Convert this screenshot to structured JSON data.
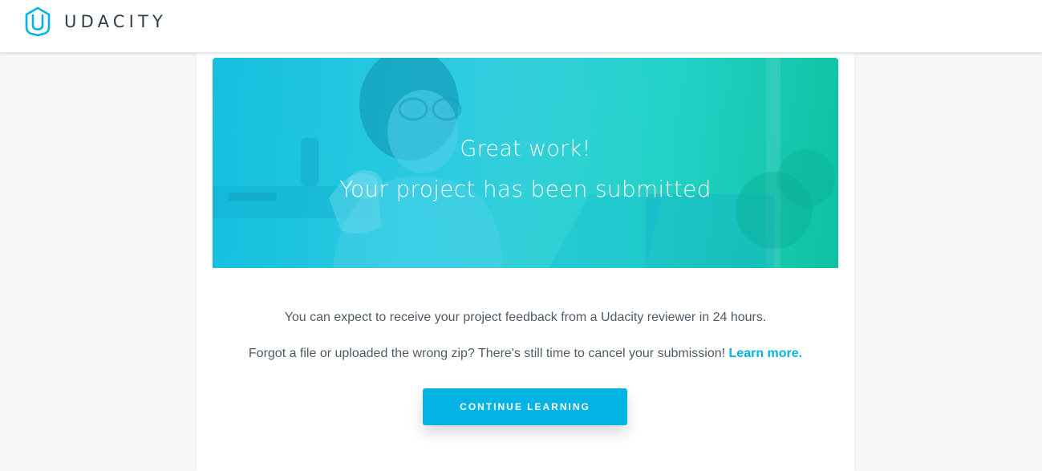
{
  "brand": {
    "name": "UDACITY",
    "logo_icon": "udacity-u-logo",
    "accent_color": "#02b3e4"
  },
  "hero": {
    "title": "Great work!",
    "subtitle": "Your project has been submitted",
    "image": "student-with-coffee-photo",
    "overlay_colors": [
      "#16bfe0",
      "#0fc1a0"
    ]
  },
  "message": {
    "feedback_text": "You can expect to receive your project feedback from a Udacity reviewer in 24 hours.",
    "cancel_text": "Forgot a file or uploaded the wrong zip? There's still time to cancel your submission!",
    "learn_more_label": "Learn more."
  },
  "actions": {
    "continue_label": "CONTINUE LEARNING"
  }
}
